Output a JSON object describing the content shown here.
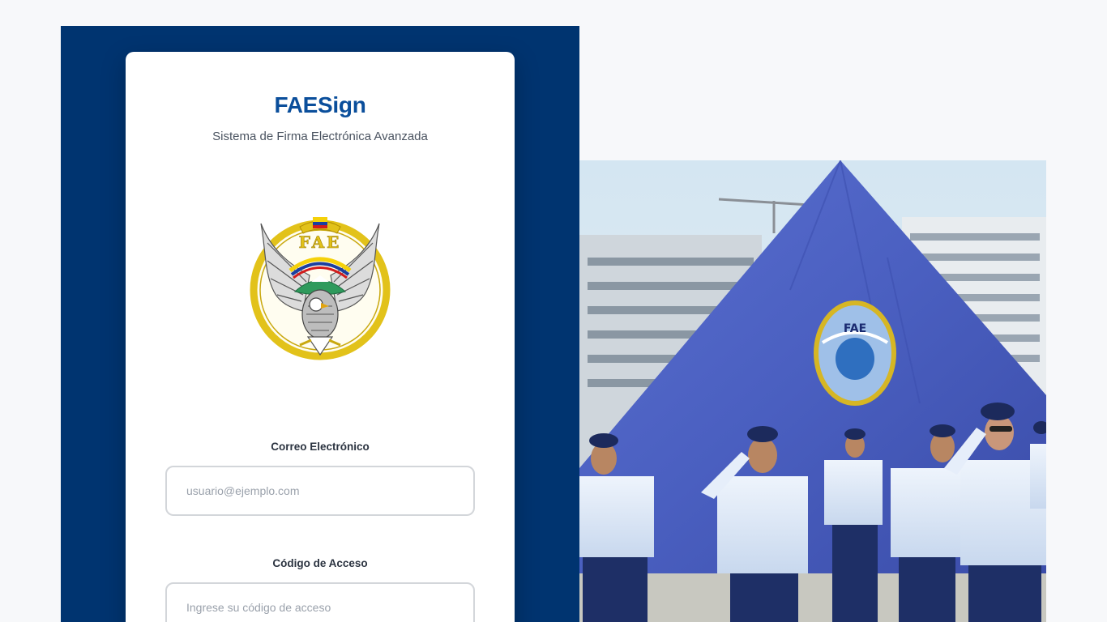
{
  "app": {
    "title": "FAESign",
    "subtitle": "Sistema de Firma Electrónica Avanzada"
  },
  "emblem": {
    "text": "FAE"
  },
  "form": {
    "email": {
      "label": "Correo Electrónico",
      "placeholder": "usuario@ejemplo.com",
      "value": ""
    },
    "code": {
      "label": "Código de Acceso",
      "placeholder": "Ingrese su código de acceso",
      "value": ""
    }
  },
  "photo": {
    "flag_text": "FAE"
  },
  "colors": {
    "brand_navy": "#003470",
    "title_blue": "#0a4e9b",
    "page_bg": "#f7f8fa",
    "flag_blue": "#4a5fc0"
  }
}
